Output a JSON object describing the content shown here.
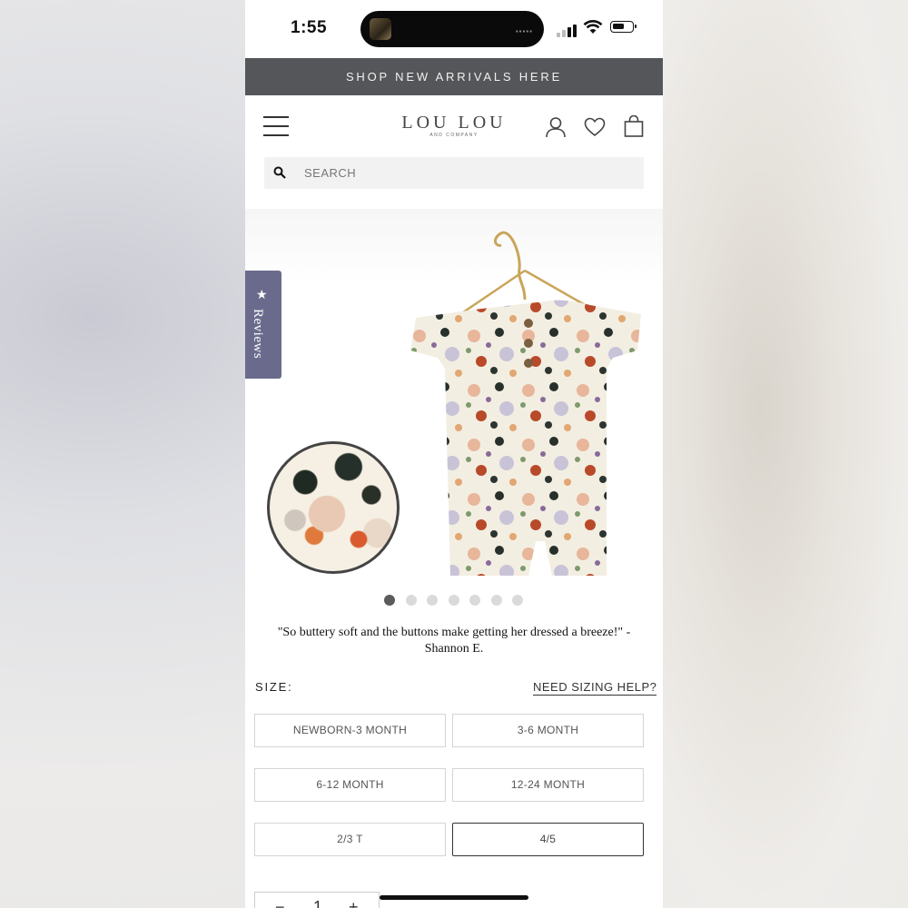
{
  "status_bar": {
    "time": "1:55"
  },
  "banner": {
    "text": "SHOP NEW ARRIVALS HERE"
  },
  "header": {
    "logo_main": "LOU LOU",
    "logo_sub": "AND COMPANY",
    "icons": [
      "menu-icon",
      "account-icon",
      "heart-icon",
      "bag-icon"
    ]
  },
  "search": {
    "placeholder": "SEARCH"
  },
  "reviews_tab": {
    "label": "Reviews",
    "icon": "star-icon"
  },
  "gallery": {
    "slide_count": 7,
    "active_slide": 1
  },
  "testimonial": {
    "quote": "\"So buttery soft and the buttons make getting her dressed a breeze!\"",
    "author": "- Shannon E."
  },
  "size": {
    "label": "SIZE:",
    "help_link": "NEED SIZING HELP?",
    "options": [
      "NEWBORN-3 MONTH",
      "3-6 MONTH",
      "6-12 MONTH",
      "12-24 MONTH",
      "2/3 T",
      "4/5"
    ],
    "selected": "4/5"
  },
  "quantity": {
    "minus": "−",
    "value": "1",
    "plus": "+"
  },
  "colors": {
    "banner_bg": "#545659",
    "reviews_tab_bg": "#6a6b8c"
  }
}
